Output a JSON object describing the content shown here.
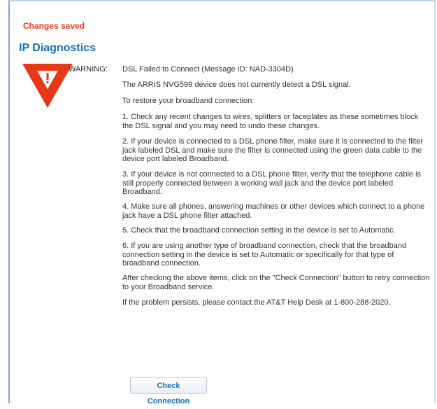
{
  "status": "Changes saved",
  "page_title": "IP Diagnostics",
  "warning": {
    "label": "WARNING:",
    "icon": "warning-triangle-icon",
    "icon_color": "#e8381a"
  },
  "messages": [
    "DSL Failed to Connect (Message ID: NAD-3304D)",
    "The ARRIS NVG599 device does not currently detect a DSL signal.",
    "To restore your broadband connection:",
    "1. Check any recent changes to wires, splitters or faceplates as these sometimes block the DSL signal and you may need to undo these changes.",
    "2. If your device is connected to a DSL phone filter, make sure it is connected to the filter jack labeled DSL and make sure the filter is connected using the green data cable to the device port labeled Broadband.",
    "3. If your device is not connected to a DSL phone filter, verify that the telephone cable is still properly connected between a working wall jack and the device port labeled Broadband.",
    "4. Make sure all phones, answering machines or other devices which connect to a phone jack have a DSL phone filter attached.",
    "5. Check that the broadband connection setting in the device is set to Automatic.",
    "6. If you are using another type of broadband connection, check that the broadband connection setting in the device is set to Automatic or specifically for that type of broadband connection.",
    "After checking the above items, click on the \"Check Connection\" button to retry connection to your Broadband service.",
    "If the problem persists, please contact the AT&T Help Desk at 1-800-288-2020."
  ],
  "check_button_label": "Check Connection",
  "colors": {
    "status_red": "#e8381a",
    "title_blue": "#1a6fb3"
  }
}
